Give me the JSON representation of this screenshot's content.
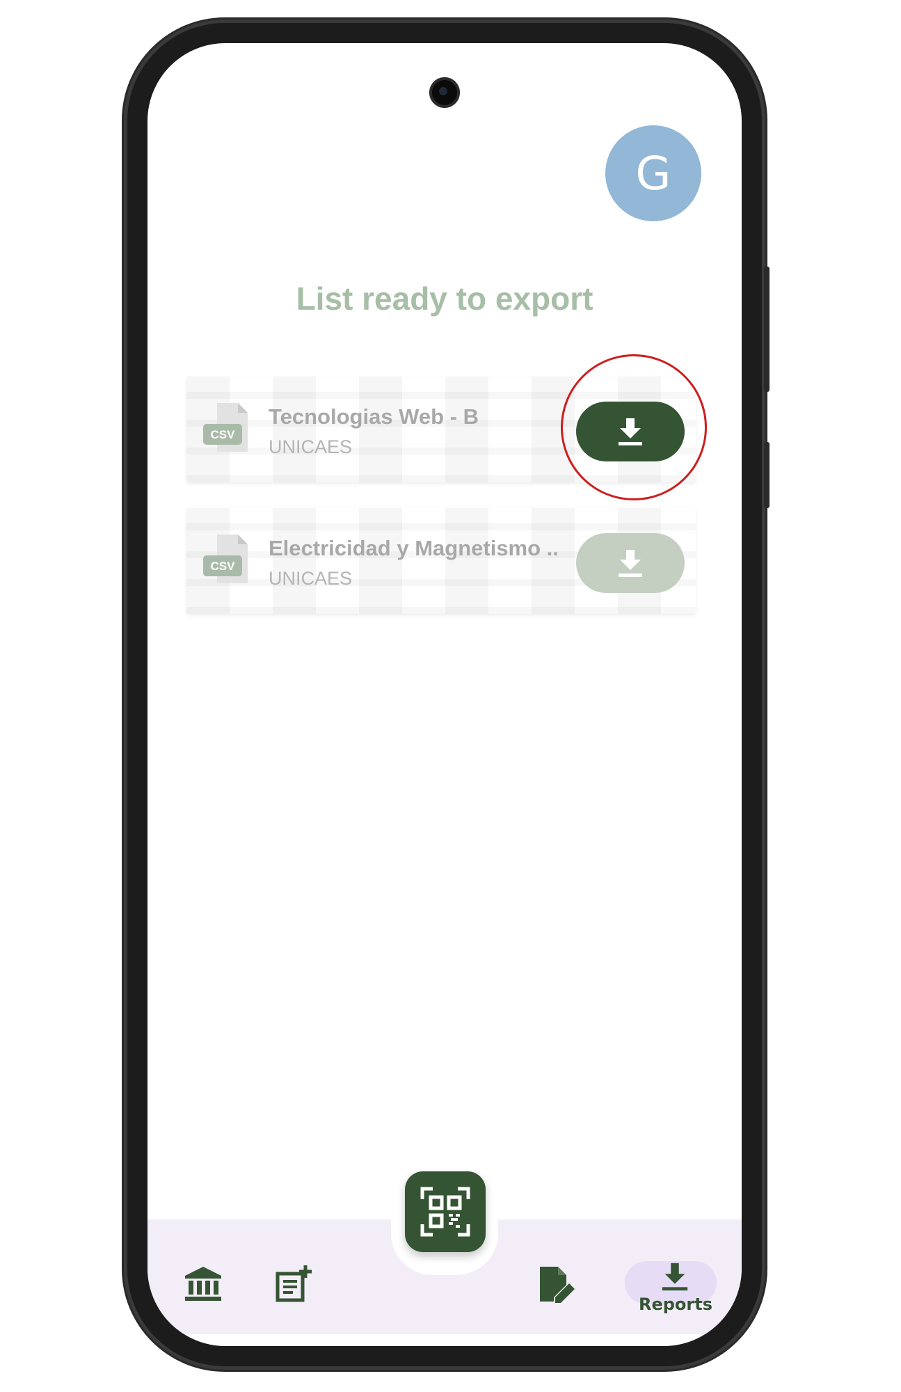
{
  "header": {
    "avatar_letter": "G"
  },
  "main": {
    "title": "List ready to export",
    "files": [
      {
        "file_type": "CSV",
        "name": "Tecnologias Web - B",
        "institution": "UNICAES",
        "download_state": "active",
        "highlighted": true
      },
      {
        "file_type": "CSV",
        "name": "Electricidad y Magnetismo ..",
        "institution": "UNICAES",
        "download_state": "faded",
        "highlighted": false
      }
    ]
  },
  "bottom_nav": {
    "items": [
      {
        "icon": "bank-icon"
      },
      {
        "icon": "add-note-icon"
      },
      {
        "icon": "qr-scan-icon"
      },
      {
        "icon": "edit-document-icon"
      },
      {
        "icon": "download-icon",
        "label": "Reports",
        "selected": true
      }
    ]
  },
  "colors": {
    "primary": "#355433",
    "title_muted": "#a7bea7",
    "avatar": "#93b7d6",
    "nav_background": "#f3edf7",
    "nav_selected_pill": "#e6dcf5",
    "highlight_ring": "#cc1f1f"
  }
}
